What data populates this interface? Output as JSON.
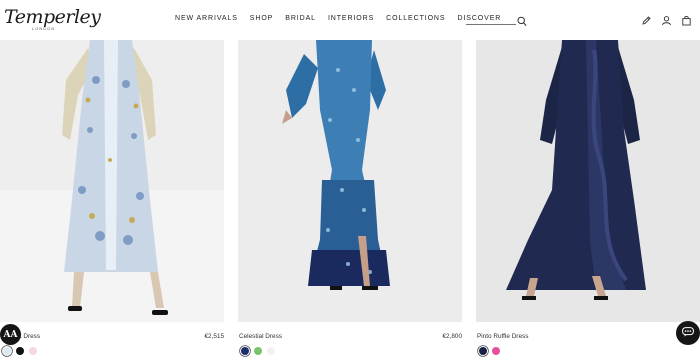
{
  "brand": {
    "logo": "Temperley",
    "logo_sub": "LONDON"
  },
  "nav": [
    "NEW ARRIVALS",
    "SHOP",
    "BRIDAL",
    "INTERIORS",
    "COLLECTIONS",
    "DISCOVER"
  ],
  "search": {
    "placeholder": "",
    "icon": "search-icon"
  },
  "header_icons": [
    "pencil-icon",
    "account-icon",
    "bag-icon"
  ],
  "products": [
    {
      "name": "V-Neck Dress",
      "price": "€2,515",
      "swatches": [
        "#dce8f2",
        "#111111",
        "#f3d9de"
      ],
      "selected_swatch": 0
    },
    {
      "name": "Celestial Dress",
      "price": "€2,800",
      "swatches": [
        "#1b2f6b",
        "#79c36a",
        "#f1f1f1"
      ],
      "selected_swatch": 0
    },
    {
      "name": "Pinto Ruffle Dress",
      "price": "",
      "swatches": [
        "#1a1f45",
        "#e64f9b"
      ],
      "selected_swatch": 0
    }
  ],
  "accessibility_button": "AA",
  "chat_icon": "chat-icon",
  "colors": {
    "background": "#ffffff",
    "photo_bg": "#ededed",
    "text": "#222222",
    "button_dark": "#151515"
  }
}
